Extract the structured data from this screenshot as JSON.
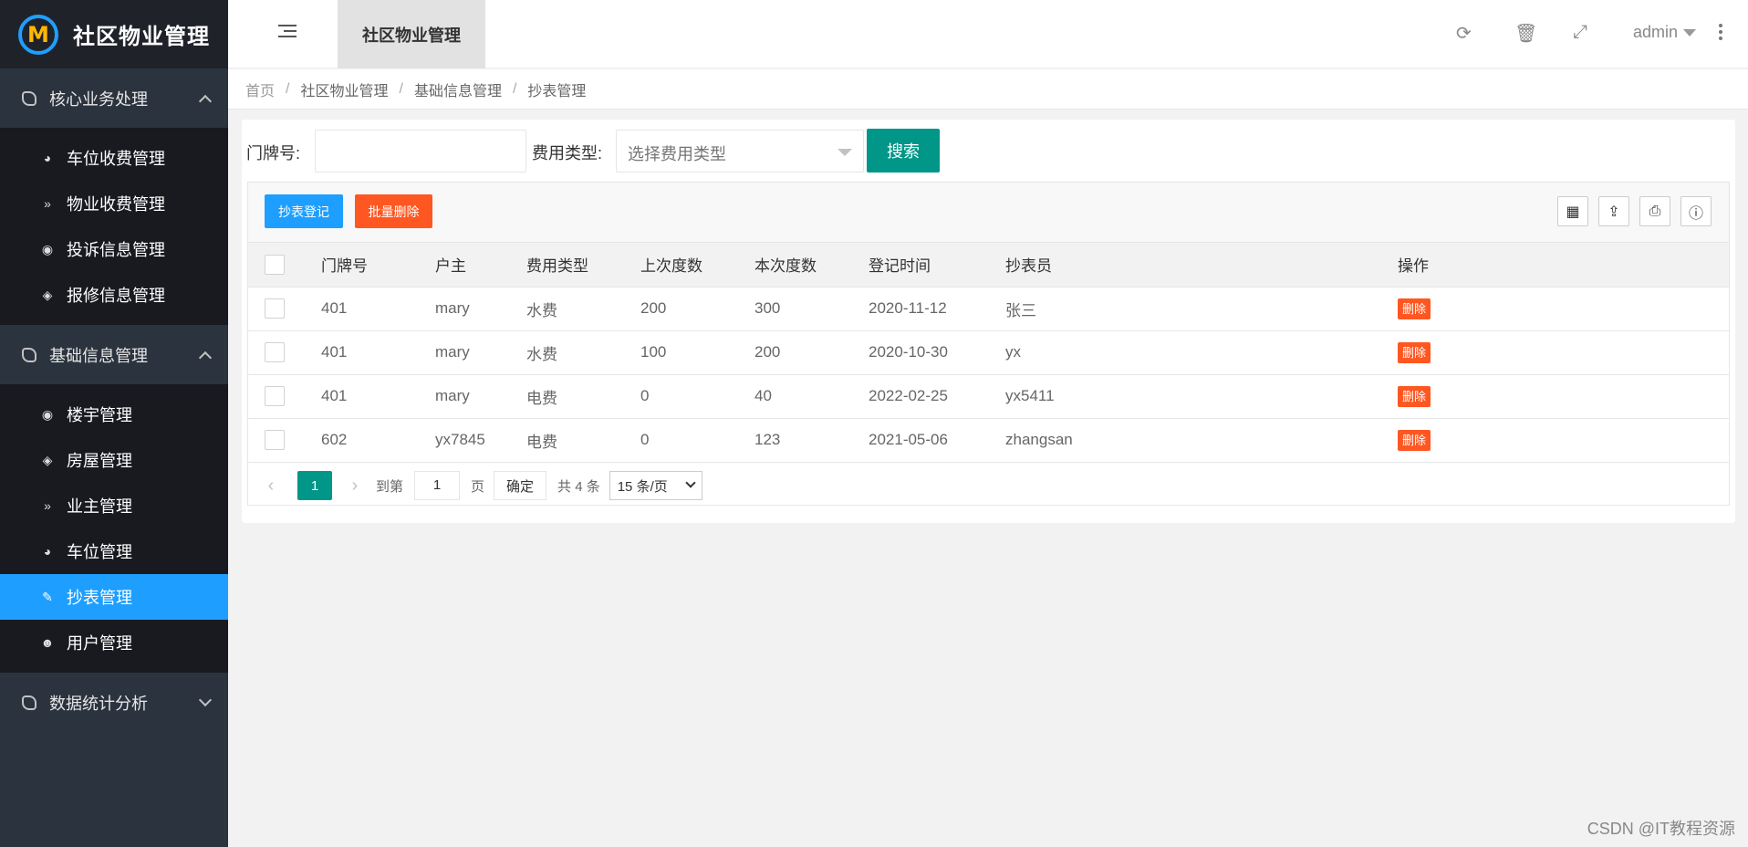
{
  "app": {
    "title": "社区物业管理"
  },
  "sidebar": {
    "groups": [
      {
        "label": "核心业务处理",
        "items": [
          {
            "label": "车位收费管理",
            "icon": "dashboard-icon"
          },
          {
            "label": "物业收费管理",
            "icon": "chevrons-down-icon"
          },
          {
            "label": "投诉信息管理",
            "icon": "target-icon"
          },
          {
            "label": "报修信息管理",
            "icon": "compass-icon"
          }
        ]
      },
      {
        "label": "基础信息管理",
        "items": [
          {
            "label": "楼宇管理",
            "icon": "target-icon"
          },
          {
            "label": "房屋管理",
            "icon": "compass-icon"
          },
          {
            "label": "业主管理",
            "icon": "chevrons-down-icon"
          },
          {
            "label": "车位管理",
            "icon": "dashboard-icon"
          },
          {
            "label": "抄表管理",
            "icon": "edit-icon",
            "active": true
          },
          {
            "label": "用户管理",
            "icon": "user-icon"
          }
        ]
      },
      {
        "label": "数据统计分析",
        "items": []
      }
    ]
  },
  "header": {
    "tab_label": "社区物业管理",
    "user": "admin"
  },
  "breadcrumb": [
    "首页",
    "社区物业管理",
    "基础信息管理",
    "抄表管理"
  ],
  "search": {
    "door_label": "门牌号:",
    "door_value": "",
    "fee_label": "费用类型:",
    "fee_placeholder": "选择费用类型",
    "button": "搜索"
  },
  "toolbar": {
    "register_label": "抄表登记",
    "batch_delete_label": "批量删除"
  },
  "table": {
    "columns": [
      "门牌号",
      "户主",
      "费用类型",
      "上次度数",
      "本次度数",
      "登记时间",
      "抄表员",
      "操作"
    ],
    "rows": [
      {
        "door": "401",
        "owner": "mary",
        "fee": "水费",
        "prev": "200",
        "curr": "300",
        "date": "2020-11-12",
        "reader": "张三",
        "action": "删除"
      },
      {
        "door": "401",
        "owner": "mary",
        "fee": "水费",
        "prev": "100",
        "curr": "200",
        "date": "2020-10-30",
        "reader": "yx",
        "action": "删除"
      },
      {
        "door": "401",
        "owner": "mary",
        "fee": "电费",
        "prev": "0",
        "curr": "40",
        "date": "2022-02-25",
        "reader": "yx5411",
        "action": "删除"
      },
      {
        "door": "602",
        "owner": "yx7845",
        "fee": "电费",
        "prev": "0",
        "curr": "123",
        "date": "2021-05-06",
        "reader": "zhangsan",
        "action": "删除"
      }
    ]
  },
  "pager": {
    "current": "1",
    "goto_label": "到第",
    "goto_value": "1",
    "page_unit": "页",
    "confirm": "确定",
    "total": "共 4 条",
    "page_size": "15 条/页"
  },
  "watermark": "CSDN @IT教程资源",
  "colors": {
    "sidebar_bg": "#2b333e",
    "logo_bg": "#20222a",
    "submenu_bg": "#181a20",
    "active": "#1e9fff",
    "primary_green": "#009688",
    "danger_orange": "#ff5722"
  }
}
